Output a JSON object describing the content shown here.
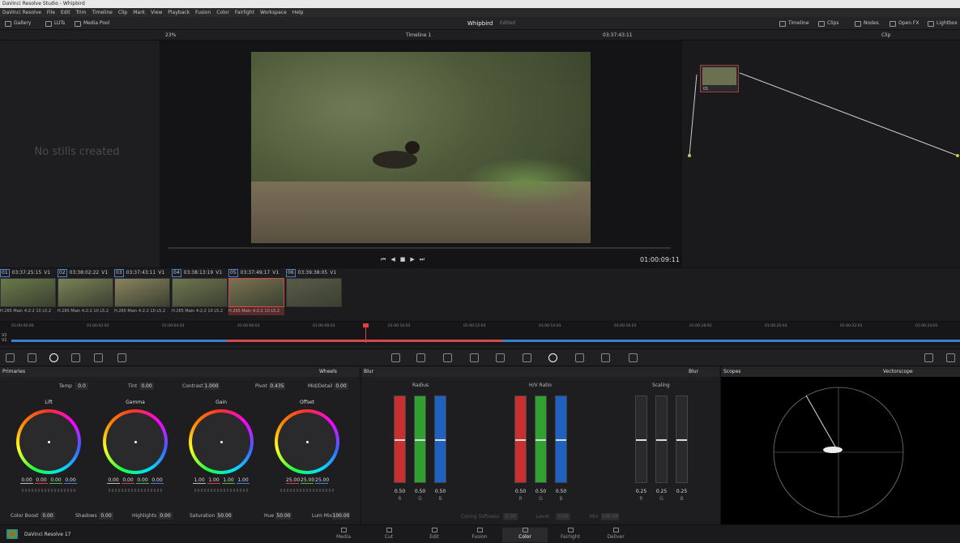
{
  "window_title": "DaVinci Resolve Studio - Whipbird",
  "menu": [
    "DaVinci Resolve",
    "File",
    "Edit",
    "Trim",
    "Timeline",
    "Clip",
    "Mark",
    "View",
    "Playback",
    "Fusion",
    "Color",
    "Fairlight",
    "Workspace",
    "Help"
  ],
  "topbar": {
    "gallery": "Gallery",
    "luts": "LUTs",
    "media_pool": "Media Pool",
    "project": "Whipbird",
    "project_status": "Edited",
    "timeline": "Timeline",
    "clips": "Clips",
    "nodes": "Nodes",
    "open_fx": "Open FX",
    "lightbox": "Lightbox"
  },
  "viewer": {
    "zoom": "23%",
    "timeline_name": "Timeline 1",
    "timecode": "03:37:43:11",
    "playhead_tc": "01:00:09:11",
    "node_mode": "Clip"
  },
  "gallery": {
    "empty_text": "No stills created"
  },
  "node": {
    "label": "01"
  },
  "clips": [
    {
      "num": "01",
      "tc": "03:37:25:15",
      "track": "V1",
      "codec": "H.265 Main 4:2:2 10 L5.2"
    },
    {
      "num": "02",
      "tc": "03:38:02:22",
      "track": "V1",
      "codec": "H.265 Main 4:2:2 10 L5.2"
    },
    {
      "num": "03",
      "tc": "03:37:43:11",
      "track": "V1",
      "codec": "H.265 Main 4:2:2 10 L5.2"
    },
    {
      "num": "04",
      "tc": "03:38:13:19",
      "track": "V1",
      "codec": "H.265 Main 4:2:2 10 L5.2"
    },
    {
      "num": "05",
      "tc": "03:37:49:17",
      "track": "V1",
      "codec": "H.265 Main 4:2:2 10 L5.2"
    },
    {
      "num": "06",
      "tc": "03:39:38:05",
      "track": "V1",
      "codec": ""
    }
  ],
  "timeline": {
    "ruler": [
      "01:00:00:00",
      "01:00:02:03",
      "01:00:04:03",
      "01:00:06:03",
      "01:00:08:03",
      "01:00:10:03",
      "01:00:12:03",
      "01:00:14:03",
      "01:00:16:03",
      "01:00:18:03",
      "01:00:20:03",
      "01:00:22:03",
      "01:00:24:03"
    ],
    "tracks": [
      "V2",
      "V1"
    ]
  },
  "primaries": {
    "title": "Primaries",
    "mode": "Wheels",
    "temp_label": "Temp",
    "temp": "0.0",
    "tint_label": "Tint",
    "tint": "0.00",
    "contrast_label": "Contrast",
    "contrast": "1.000",
    "pivot_label": "Pivot",
    "pivot": "0.435",
    "middetail_label": "Mid/Detail",
    "middetail": "0.00",
    "wheels": [
      {
        "name": "Lift",
        "vals": [
          "0.00",
          "0.00",
          "0.00",
          "0.00"
        ]
      },
      {
        "name": "Gamma",
        "vals": [
          "0.00",
          "0.00",
          "0.00",
          "0.00"
        ]
      },
      {
        "name": "Gain",
        "vals": [
          "1.00",
          "1.00",
          "1.00",
          "1.00"
        ]
      },
      {
        "name": "Offset",
        "vals": [
          "25.00",
          "25.00",
          "25.00"
        ]
      }
    ],
    "colorboost_label": "Color Boost",
    "colorboost": "0.00",
    "shadows_label": "Shadows",
    "shadows": "0.00",
    "highlights_label": "Highlights",
    "highlights": "0.00",
    "saturation_label": "Saturation",
    "saturation": "50.00",
    "hue_label": "Hue",
    "hue": "50.00",
    "lummix_label": "Lum Mix",
    "lummix": "100.00"
  },
  "blur": {
    "title": "Blur",
    "mode": "Blur",
    "radius_label": "Radius",
    "hv_label": "H/V Ratio",
    "scaling_label": "Scaling",
    "radius": [
      "0.50",
      "0.50",
      "0.50"
    ],
    "hv": [
      "0.50",
      "0.50",
      "0.50"
    ],
    "scaling": [
      "0.25",
      "0.25",
      "0.25"
    ],
    "channels": [
      "R",
      "G",
      "B"
    ],
    "coring_label": "Coring Softness",
    "coring": "0.00",
    "level_label": "Level",
    "level": "0.00",
    "mix_label": "Mix",
    "mix": "100.00"
  },
  "scopes": {
    "title": "Scopes",
    "mode": "Vectorscope"
  },
  "pages": [
    "Media",
    "Cut",
    "Edit",
    "Fusion",
    "Color",
    "Fairlight",
    "Deliver"
  ],
  "active_page": "Color",
  "app_name": "DaVinci Resolve 17",
  "colors": {
    "accent": "#e04040",
    "clip_selected": "#d44a4a",
    "blue_track": "#3b7fd0"
  }
}
